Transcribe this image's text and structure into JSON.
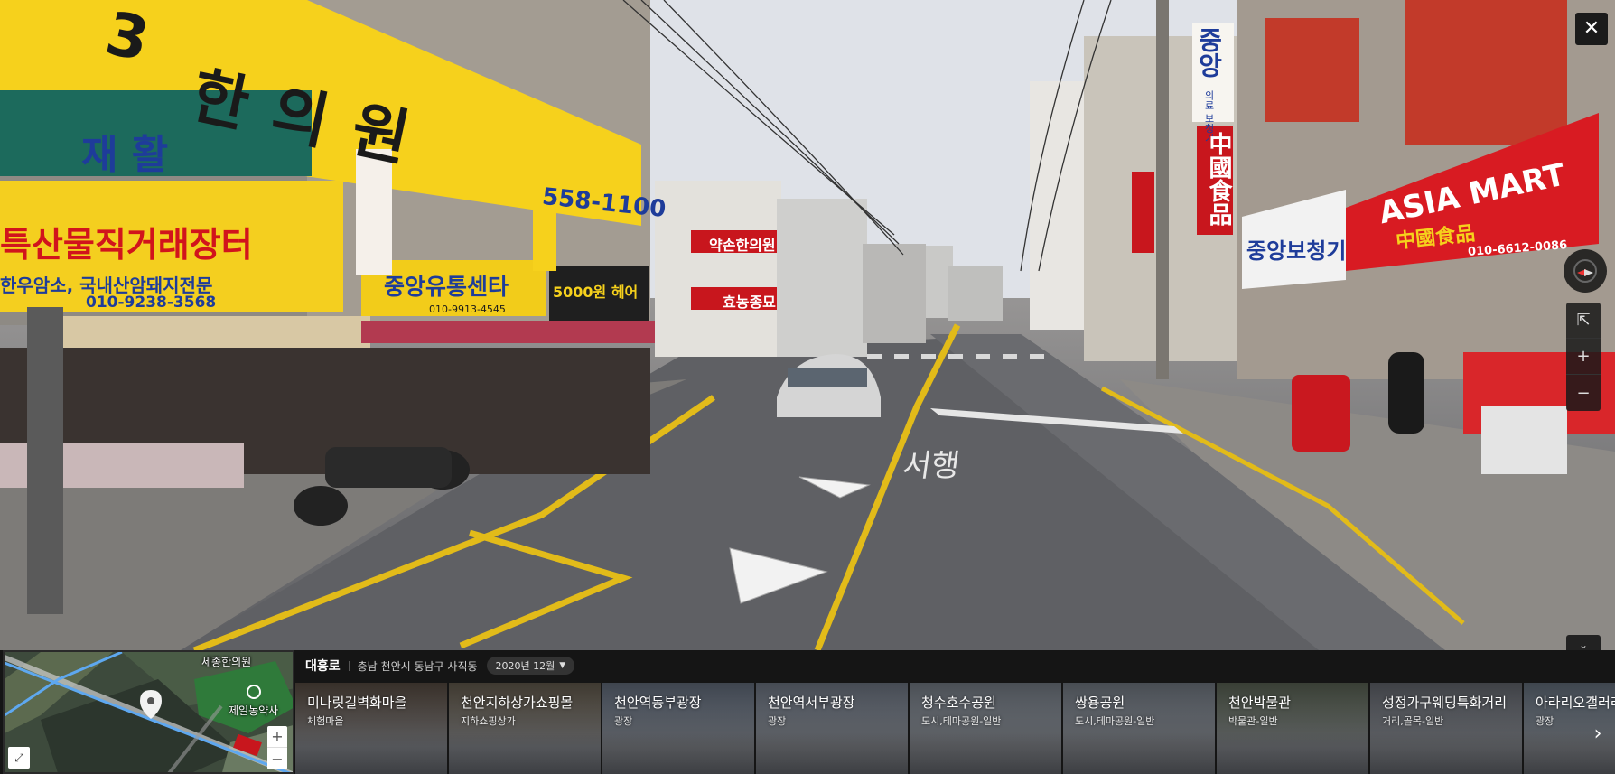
{
  "viewer": {
    "close_icon": "close-icon",
    "compass_icon": "compass-icon",
    "tools": [
      {
        "name": "share-icon",
        "glyph": "⇱"
      },
      {
        "name": "zoom-in-icon",
        "glyph": "+"
      },
      {
        "name": "zoom-out-icon",
        "glyph": "−"
      }
    ],
    "collapse_glyph": "⌄"
  },
  "signs": {
    "hanuiwon_num": "3",
    "hanuiwon": "한의원",
    "jaehwal": "재 활",
    "phone_558": "558-1100",
    "trade_left": "특산물직거래장터",
    "hanwoo": "한우암소, 국내산암돼지전문",
    "phone_left": "010-9238-3568",
    "jungang_yutong": "중앙유통센타",
    "phone_yutong": "010-9913-4545",
    "hair": "5000원 헤어",
    "yaksonhan": "약손한의원",
    "hyonong": "효농종묘",
    "jungang_hear": "중앙",
    "jungang_hear2": "의료 보청기",
    "chinese_food": "中國食品",
    "jungang_bocheong": "중앙보청기",
    "asia_mart": "ASIA MART",
    "asia_mart_sub": "中國食品",
    "asia_mart_phone": "010-6612-0086",
    "jaehwal2": "재활",
    "road_marking": "서행"
  },
  "minimap": {
    "labels": [
      "세종한의원",
      "제일농약사"
    ]
  },
  "location": {
    "road": "대흥로",
    "address": "충남 천안시 동남구 사직동",
    "date": "2020년 12월"
  },
  "nearby": [
    {
      "title": "미나릿길벽화마을",
      "category": "체험마을",
      "bg": "#7a6a5d"
    },
    {
      "title": "천안지하상가쇼핑몰",
      "category": "지하쇼핑상가",
      "bg": "#8b7f6c"
    },
    {
      "title": "천안역동부광장",
      "category": "광장",
      "bg": "#8a98ad"
    },
    {
      "title": "천안역서부광장",
      "category": "광장",
      "bg": "#9aa5b7"
    },
    {
      "title": "청수호수공원",
      "category": "도시,테마공원-일반",
      "bg": "#a4aebb"
    },
    {
      "title": "쌍용공원",
      "category": "도시,테마공원-일반",
      "bg": "#9fa9b6"
    },
    {
      "title": "천안박물관",
      "category": "박물관-일반",
      "bg": "#7e8a76"
    },
    {
      "title": "성정가구웨딩특화거리",
      "category": "거리,골목-일반",
      "bg": "#8a8f99"
    },
    {
      "title": "아라리오갤러리",
      "category": "광장",
      "bg": "#8a9aac"
    }
  ],
  "colors": {
    "accent_yellow": "#f6d11c",
    "sign_red": "#c8161d",
    "bar_bg": "#151515"
  }
}
